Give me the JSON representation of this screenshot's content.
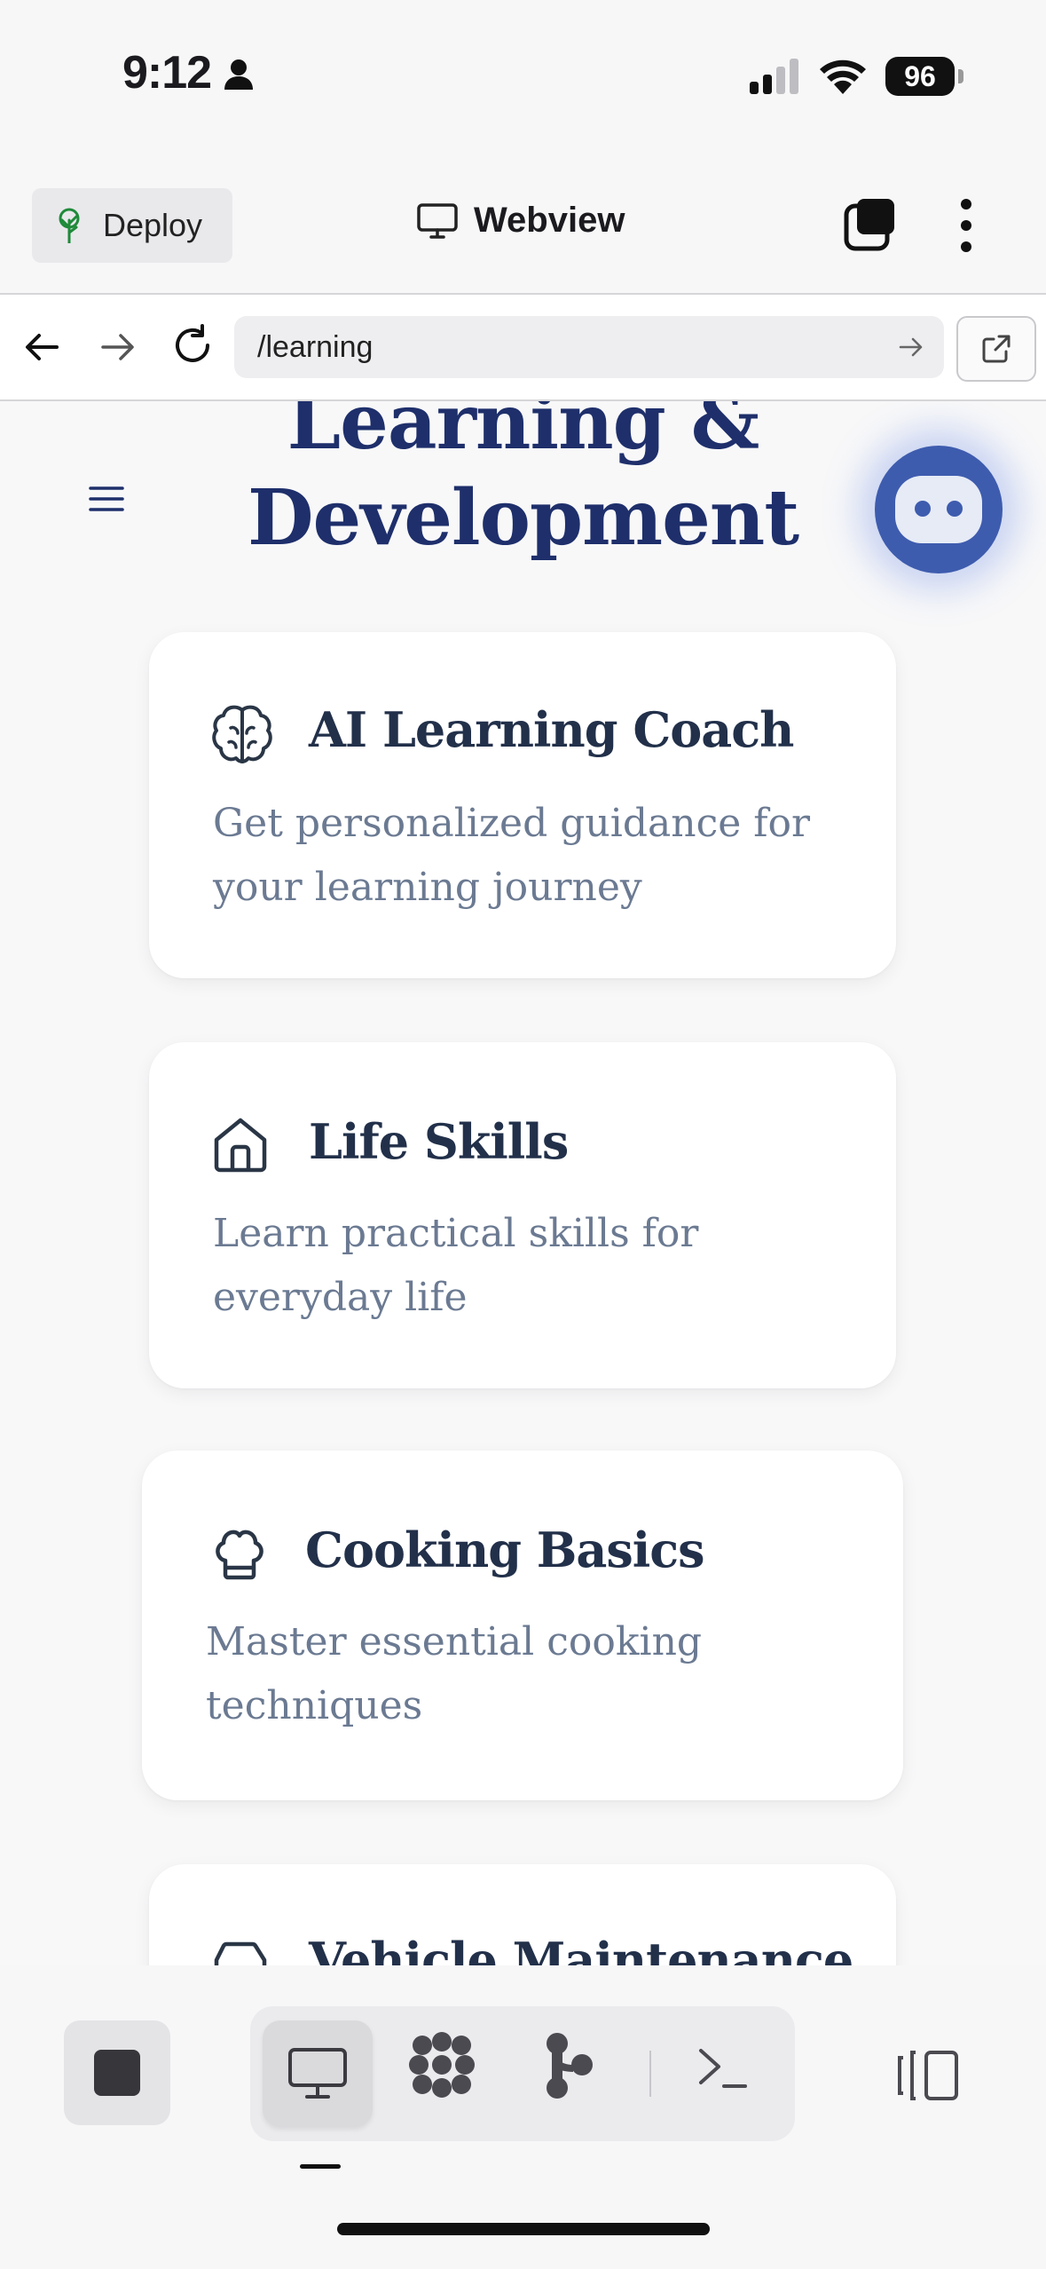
{
  "status_bar": {
    "time": "9:12",
    "battery": "96"
  },
  "header": {
    "deploy_label": "Deploy",
    "title": "Webview"
  },
  "url_bar": {
    "url": "/learning"
  },
  "page": {
    "title_line1": "Learning &",
    "title_line2": "Development",
    "cards": [
      {
        "icon": "brain-icon",
        "title": "AI Learning Coach",
        "desc_line1": "Get personalized guidance for",
        "desc_line2": "your learning journey"
      },
      {
        "icon": "home-icon",
        "title": "Life Skills",
        "desc_line1": "Learn practical skills for",
        "desc_line2": "everyday life"
      },
      {
        "icon": "chef-hat-icon",
        "title": "Cooking Basics",
        "desc_line1": "Master essential cooking",
        "desc_line2": "techniques"
      },
      {
        "icon": "car-icon",
        "title": "Vehicle Maintenance",
        "desc_line1": "",
        "desc_line2": ""
      }
    ]
  },
  "toolbar": {
    "tools": [
      "monitor-icon",
      "ai-agent-icon",
      "git-icon",
      "shell-icon"
    ]
  },
  "colors": {
    "title": "#1e2f6b",
    "bot": "#3e5cae",
    "card_title": "#22304a",
    "card_desc": "#6b7a92"
  }
}
